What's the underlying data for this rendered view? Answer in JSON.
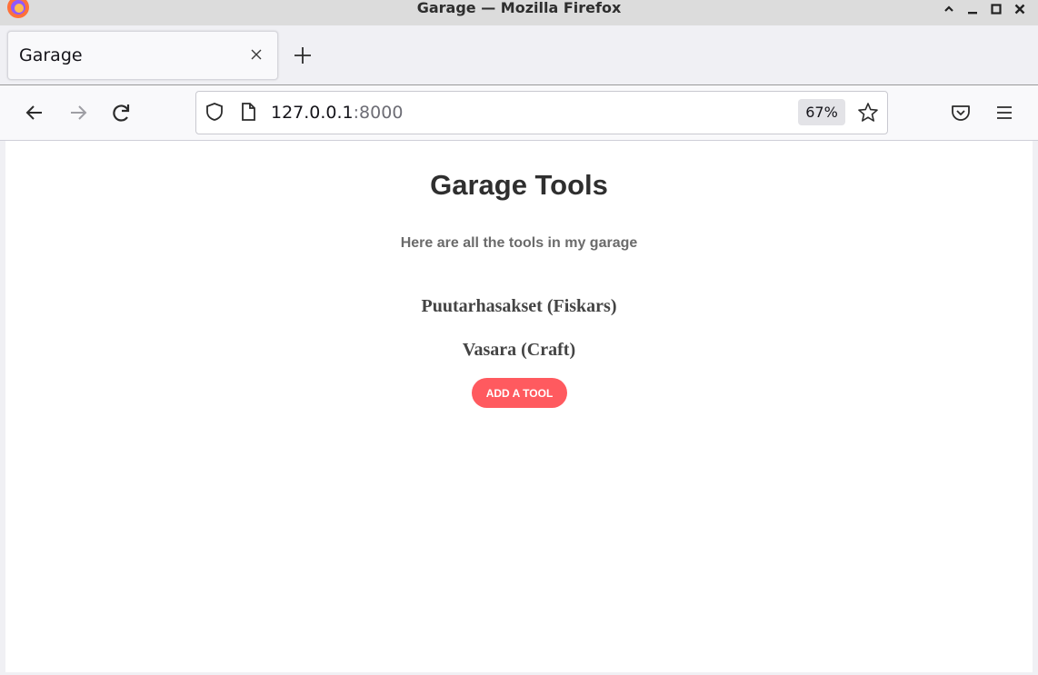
{
  "window": {
    "title": "Garage — Mozilla Firefox",
    "controls": [
      "minimize-up",
      "minimize",
      "maximize",
      "close"
    ]
  },
  "tabs": [
    {
      "label": "Garage",
      "active": true
    }
  ],
  "navbar": {
    "url_host": "127.0.0.1",
    "url_port": ":8000",
    "zoom": "67%"
  },
  "page": {
    "title": "Garage Tools",
    "subtitle": "Here are all the tools in my garage",
    "tools": [
      {
        "label": "Puutarhasakset (Fiskars)"
      },
      {
        "label": "Vasara (Craft)"
      }
    ],
    "add_button_label": "ADD A TOOL"
  },
  "colors": {
    "accent_button": "#ff5a5f",
    "title_text": "#2f2f2f",
    "subtitle_text": "#6b6b6b"
  },
  "icons": {
    "browser_logo": "firefox-logo-icon",
    "tab_close": "close-icon",
    "new_tab": "plus-icon",
    "back": "arrow-left-icon",
    "forward": "arrow-right-icon",
    "reload": "reload-icon",
    "shield": "shield-icon",
    "page": "page-icon",
    "bookmark": "star-icon",
    "pocket": "pocket-icon",
    "menu": "hamburger-menu-icon"
  }
}
